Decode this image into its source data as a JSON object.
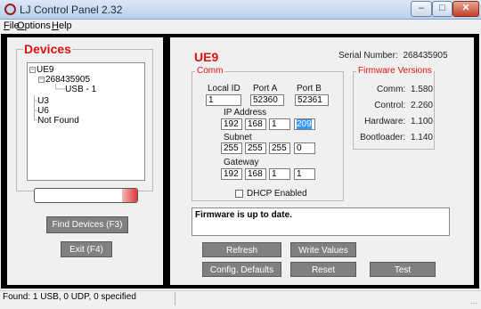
{
  "window": {
    "title": "LJ Control Panel 2.32",
    "minimize": "–",
    "maximize": "□",
    "close": "✕"
  },
  "menu": {
    "file_key": "F",
    "file_rest": "ile",
    "options_key": "O",
    "options_rest": "ptions",
    "help_key": "H",
    "help_rest": "elp"
  },
  "devices": {
    "title": "Devices",
    "tree": {
      "ue9": "UE9",
      "serial_node": "268435905",
      "usb_node": "USB - 1",
      "u3": "U3",
      "u6": "U6",
      "not_found": "Not Found"
    },
    "progress": 0.15,
    "find_button": "Find Devices (F3)",
    "exit_button": "Exit (F4)"
  },
  "device": {
    "title": "UE9",
    "serial_label": "Serial Number:",
    "serial_value": "268435905"
  },
  "comm": {
    "title": "Comm",
    "local_id_label": "Local ID",
    "local_id_value": "1",
    "port_a_label": "Port A",
    "port_a_value": "52360",
    "port_b_label": "Port B",
    "port_b_value": "52361",
    "ip_label": "IP Address",
    "ip": [
      "192",
      "168",
      "1",
      "209"
    ],
    "subnet_label": "Subnet",
    "subnet": [
      "255",
      "255",
      "255",
      "0"
    ],
    "gateway_label": "Gateway",
    "gateway": [
      "192",
      "168",
      "1",
      "1"
    ],
    "dhcp_label": "DHCP Enabled",
    "dhcp_checked": false
  },
  "firmware": {
    "title": "Firmware Versions",
    "rows": [
      {
        "label": "Comm:",
        "value": "1.580"
      },
      {
        "label": "Control:",
        "value": "2.260"
      },
      {
        "label": "Hardware:",
        "value": "1.100"
      },
      {
        "label": "Bootloader:",
        "value": "1.140"
      }
    ]
  },
  "status_message": "Firmware is up to date.",
  "buttons": {
    "refresh": "Refresh",
    "write_values": "Write Values",
    "config_defaults": "Config. Defaults",
    "reset": "Reset",
    "test": "Test"
  },
  "statusbar": {
    "text": "Found: 1 USB, 0 UDP, 0 specified"
  },
  "colors": {
    "accent_red": "#dd1111",
    "button_gray": "#808080",
    "selection_blue": "#3399ff"
  }
}
